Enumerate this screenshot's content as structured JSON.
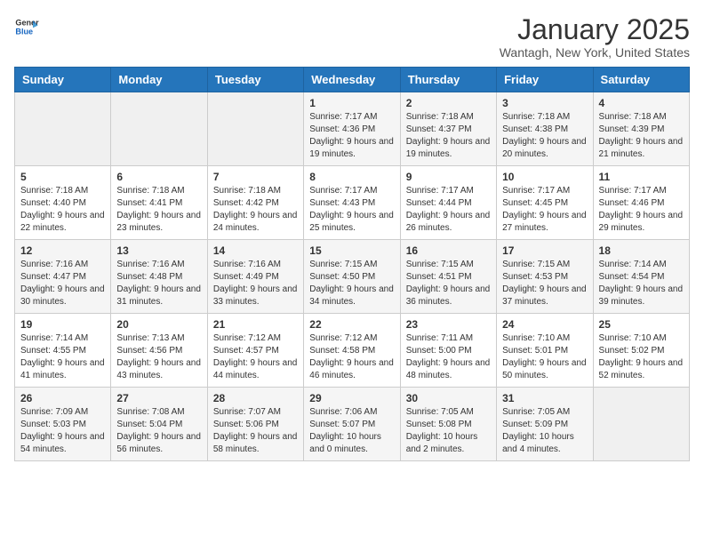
{
  "logo": {
    "general": "General",
    "blue": "Blue"
  },
  "header": {
    "month": "January 2025",
    "location": "Wantagh, New York, United States"
  },
  "weekdays": [
    "Sunday",
    "Monday",
    "Tuesday",
    "Wednesday",
    "Thursday",
    "Friday",
    "Saturday"
  ],
  "rows": [
    [
      {
        "day": "",
        "sunrise": "",
        "sunset": "",
        "daylight": ""
      },
      {
        "day": "",
        "sunrise": "",
        "sunset": "",
        "daylight": ""
      },
      {
        "day": "",
        "sunrise": "",
        "sunset": "",
        "daylight": ""
      },
      {
        "day": "1",
        "sunrise": "Sunrise: 7:17 AM",
        "sunset": "Sunset: 4:36 PM",
        "daylight": "Daylight: 9 hours and 19 minutes."
      },
      {
        "day": "2",
        "sunrise": "Sunrise: 7:18 AM",
        "sunset": "Sunset: 4:37 PM",
        "daylight": "Daylight: 9 hours and 19 minutes."
      },
      {
        "day": "3",
        "sunrise": "Sunrise: 7:18 AM",
        "sunset": "Sunset: 4:38 PM",
        "daylight": "Daylight: 9 hours and 20 minutes."
      },
      {
        "day": "4",
        "sunrise": "Sunrise: 7:18 AM",
        "sunset": "Sunset: 4:39 PM",
        "daylight": "Daylight: 9 hours and 21 minutes."
      }
    ],
    [
      {
        "day": "5",
        "sunrise": "Sunrise: 7:18 AM",
        "sunset": "Sunset: 4:40 PM",
        "daylight": "Daylight: 9 hours and 22 minutes."
      },
      {
        "day": "6",
        "sunrise": "Sunrise: 7:18 AM",
        "sunset": "Sunset: 4:41 PM",
        "daylight": "Daylight: 9 hours and 23 minutes."
      },
      {
        "day": "7",
        "sunrise": "Sunrise: 7:18 AM",
        "sunset": "Sunset: 4:42 PM",
        "daylight": "Daylight: 9 hours and 24 minutes."
      },
      {
        "day": "8",
        "sunrise": "Sunrise: 7:17 AM",
        "sunset": "Sunset: 4:43 PM",
        "daylight": "Daylight: 9 hours and 25 minutes."
      },
      {
        "day": "9",
        "sunrise": "Sunrise: 7:17 AM",
        "sunset": "Sunset: 4:44 PM",
        "daylight": "Daylight: 9 hours and 26 minutes."
      },
      {
        "day": "10",
        "sunrise": "Sunrise: 7:17 AM",
        "sunset": "Sunset: 4:45 PM",
        "daylight": "Daylight: 9 hours and 27 minutes."
      },
      {
        "day": "11",
        "sunrise": "Sunrise: 7:17 AM",
        "sunset": "Sunset: 4:46 PM",
        "daylight": "Daylight: 9 hours and 29 minutes."
      }
    ],
    [
      {
        "day": "12",
        "sunrise": "Sunrise: 7:16 AM",
        "sunset": "Sunset: 4:47 PM",
        "daylight": "Daylight: 9 hours and 30 minutes."
      },
      {
        "day": "13",
        "sunrise": "Sunrise: 7:16 AM",
        "sunset": "Sunset: 4:48 PM",
        "daylight": "Daylight: 9 hours and 31 minutes."
      },
      {
        "day": "14",
        "sunrise": "Sunrise: 7:16 AM",
        "sunset": "Sunset: 4:49 PM",
        "daylight": "Daylight: 9 hours and 33 minutes."
      },
      {
        "day": "15",
        "sunrise": "Sunrise: 7:15 AM",
        "sunset": "Sunset: 4:50 PM",
        "daylight": "Daylight: 9 hours and 34 minutes."
      },
      {
        "day": "16",
        "sunrise": "Sunrise: 7:15 AM",
        "sunset": "Sunset: 4:51 PM",
        "daylight": "Daylight: 9 hours and 36 minutes."
      },
      {
        "day": "17",
        "sunrise": "Sunrise: 7:15 AM",
        "sunset": "Sunset: 4:53 PM",
        "daylight": "Daylight: 9 hours and 37 minutes."
      },
      {
        "day": "18",
        "sunrise": "Sunrise: 7:14 AM",
        "sunset": "Sunset: 4:54 PM",
        "daylight": "Daylight: 9 hours and 39 minutes."
      }
    ],
    [
      {
        "day": "19",
        "sunrise": "Sunrise: 7:14 AM",
        "sunset": "Sunset: 4:55 PM",
        "daylight": "Daylight: 9 hours and 41 minutes."
      },
      {
        "day": "20",
        "sunrise": "Sunrise: 7:13 AM",
        "sunset": "Sunset: 4:56 PM",
        "daylight": "Daylight: 9 hours and 43 minutes."
      },
      {
        "day": "21",
        "sunrise": "Sunrise: 7:12 AM",
        "sunset": "Sunset: 4:57 PM",
        "daylight": "Daylight: 9 hours and 44 minutes."
      },
      {
        "day": "22",
        "sunrise": "Sunrise: 7:12 AM",
        "sunset": "Sunset: 4:58 PM",
        "daylight": "Daylight: 9 hours and 46 minutes."
      },
      {
        "day": "23",
        "sunrise": "Sunrise: 7:11 AM",
        "sunset": "Sunset: 5:00 PM",
        "daylight": "Daylight: 9 hours and 48 minutes."
      },
      {
        "day": "24",
        "sunrise": "Sunrise: 7:10 AM",
        "sunset": "Sunset: 5:01 PM",
        "daylight": "Daylight: 9 hours and 50 minutes."
      },
      {
        "day": "25",
        "sunrise": "Sunrise: 7:10 AM",
        "sunset": "Sunset: 5:02 PM",
        "daylight": "Daylight: 9 hours and 52 minutes."
      }
    ],
    [
      {
        "day": "26",
        "sunrise": "Sunrise: 7:09 AM",
        "sunset": "Sunset: 5:03 PM",
        "daylight": "Daylight: 9 hours and 54 minutes."
      },
      {
        "day": "27",
        "sunrise": "Sunrise: 7:08 AM",
        "sunset": "Sunset: 5:04 PM",
        "daylight": "Daylight: 9 hours and 56 minutes."
      },
      {
        "day": "28",
        "sunrise": "Sunrise: 7:07 AM",
        "sunset": "Sunset: 5:06 PM",
        "daylight": "Daylight: 9 hours and 58 minutes."
      },
      {
        "day": "29",
        "sunrise": "Sunrise: 7:06 AM",
        "sunset": "Sunset: 5:07 PM",
        "daylight": "Daylight: 10 hours and 0 minutes."
      },
      {
        "day": "30",
        "sunrise": "Sunrise: 7:05 AM",
        "sunset": "Sunset: 5:08 PM",
        "daylight": "Daylight: 10 hours and 2 minutes."
      },
      {
        "day": "31",
        "sunrise": "Sunrise: 7:05 AM",
        "sunset": "Sunset: 5:09 PM",
        "daylight": "Daylight: 10 hours and 4 minutes."
      },
      {
        "day": "",
        "sunrise": "",
        "sunset": "",
        "daylight": ""
      }
    ]
  ]
}
